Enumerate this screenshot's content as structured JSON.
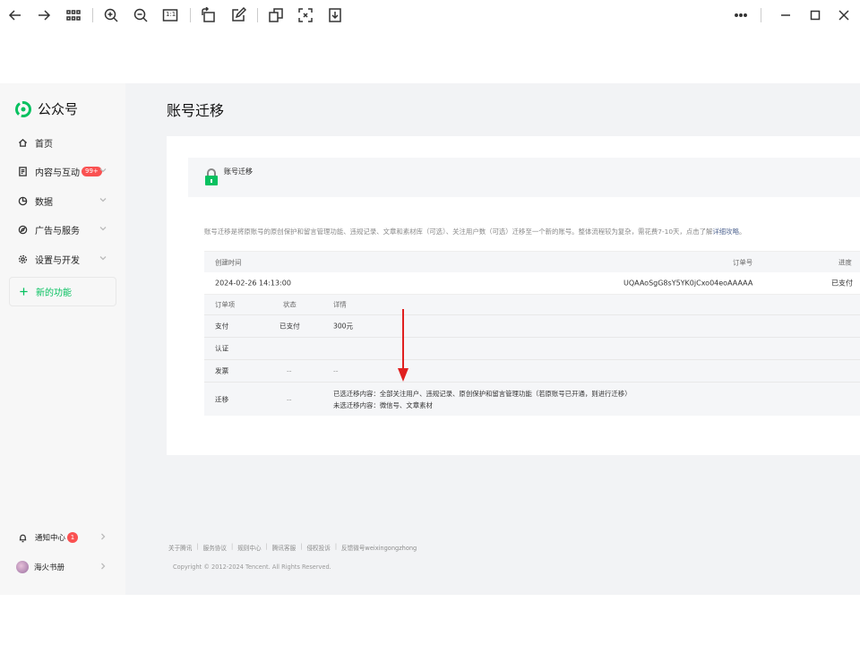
{
  "toolbar": {
    "icons": [
      "back-arrow-icon",
      "forward-arrow-icon",
      "grid-icon",
      "zoom-in-icon",
      "zoom-out-icon",
      "actual-size-icon",
      "rotate-icon",
      "edit-icon",
      "copy-icon",
      "ocr-icon",
      "download-icon",
      "more-icon",
      "minimize-icon",
      "maximize-icon",
      "close-icon"
    ],
    "actual_size_label": "1:1"
  },
  "sidebar": {
    "brand": "公众号",
    "items": [
      {
        "label": "首页",
        "icon": "home-icon"
      },
      {
        "label": "内容与互动",
        "icon": "document-icon",
        "badge": "99+"
      },
      {
        "label": "数据",
        "icon": "chart-icon"
      },
      {
        "label": "广告与服务",
        "icon": "compass-icon"
      },
      {
        "label": "设置与开发",
        "icon": "gear-icon"
      },
      {
        "label": "新的功能",
        "icon": "plus-icon"
      }
    ],
    "notification": {
      "label": "通知中心",
      "count": "1"
    },
    "account": {
      "label": "海火书册"
    }
  },
  "main": {
    "title": "账号迁移",
    "card_title": "账号迁移",
    "description": "账号迁移是将原账号的原创保护和留言管理功能、违规记录、文章和素材库（可选）、关注用户数（可选）迁移至一个新的账号。整体流程较为复杂，需花费7-10天，点击了解",
    "description_link": "详细攻略",
    "description_end": "。",
    "table": {
      "headers": {
        "created": "创建时间",
        "order_no": "订单号",
        "progress": "进度"
      },
      "row": {
        "created": "2024-02-26 14:13:00",
        "order_no": "UQAAoSgG8sY5YK0jCxo04eoAAAAA",
        "progress": "已支付"
      },
      "sub_headers": {
        "item": "订单项",
        "status": "状态",
        "detail": "详情"
      },
      "sub_rows": [
        {
          "item": "支付",
          "status": "已支付",
          "detail": "300元"
        },
        {
          "item": "认证",
          "status": "",
          "detail": ""
        },
        {
          "item": "发票",
          "status": "--",
          "detail": "--"
        },
        {
          "item": "迁移",
          "status": "--",
          "detail_line1": "已选迁移内容：全部关注用户、违规记录、原创保护和留言管理功能（若原账号已开通，则进行迁移）",
          "detail_line2": "未选迁移内容：微信号、文章素材"
        }
      ]
    }
  },
  "footer": {
    "links": [
      "关于腾讯",
      "服务协议",
      "规则中心",
      "腾讯客服",
      "侵权投诉",
      "反馈微号weixingongzhong"
    ],
    "copyright": "Copyright © 2012-2024 Tencent. All Rights Reserved."
  },
  "colors": {
    "brand_green": "#07c160",
    "badge_red": "#fa5151",
    "annotation_arrow": "#e02020",
    "link_blue": "#576b95"
  }
}
